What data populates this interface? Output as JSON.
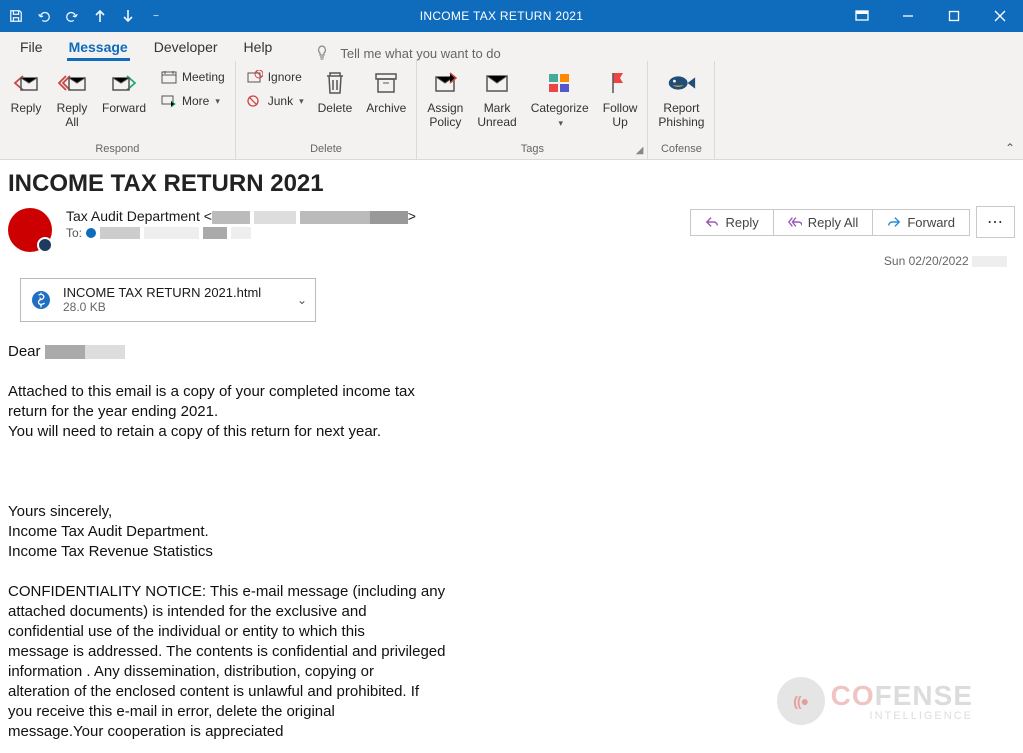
{
  "window": {
    "title": "INCOME TAX RETURN 2021"
  },
  "tabs": {
    "file": "File",
    "message": "Message",
    "developer": "Developer",
    "help": "Help",
    "tellme": "Tell me what you want to do"
  },
  "ribbon": {
    "respond": {
      "reply": "Reply",
      "reply_all": "Reply\nAll",
      "forward": "Forward",
      "meeting": "Meeting",
      "more": "More",
      "group": "Respond"
    },
    "delete": {
      "ignore": "Ignore",
      "junk": "Junk",
      "delete": "Delete",
      "archive": "Archive",
      "group": "Delete"
    },
    "tags": {
      "assign_policy": "Assign\nPolicy",
      "mark_unread": "Mark\nUnread",
      "categorize": "Categorize",
      "follow_up": "Follow\nUp",
      "group": "Tags"
    },
    "cofense": {
      "report_phishing": "Report\nPhishing",
      "group": "Cofense"
    }
  },
  "message": {
    "subject": "INCOME TAX RETURN 2021",
    "from_name": "Tax Audit Department",
    "to_label": "To:",
    "date": "Sun 02/20/2022",
    "actions": {
      "reply": "Reply",
      "reply_all": "Reply All",
      "forward": "Forward"
    },
    "attachment": {
      "name": "INCOME TAX RETURN 2021.html",
      "size": "28.0 KB"
    },
    "body": {
      "greeting": "Dear",
      "l1": "Attached to this email is a copy of your completed income tax",
      "l2": "return for the year ending 2021.",
      "l3": "You will need to retain a copy of this return for next year.",
      "sig1": "Yours sincerely,",
      "sig2": "Income Tax Audit Department.",
      "sig3": "Income Tax Revenue Statistics",
      "c1": "CONFIDENTIALITY NOTICE: This e-mail message (including any",
      "c2": "attached  documents) is intended for the exclusive and",
      "c3": "confidential use of the individual or entity to which this",
      "c4": "message is addressed. The contents is confidential and privileged",
      "c5": "information . Any dissemination, distribution, copying or",
      "c6": "alteration of the enclosed content is unlawful and prohibited. If",
      "c7": "you receive this e-mail in error,  delete the original",
      "c8": "message.Your cooperation is appreciated"
    }
  },
  "watermark": {
    "brand": "FENSE",
    "brand_co": "CO",
    "sub": "INTELLIGENCE"
  }
}
